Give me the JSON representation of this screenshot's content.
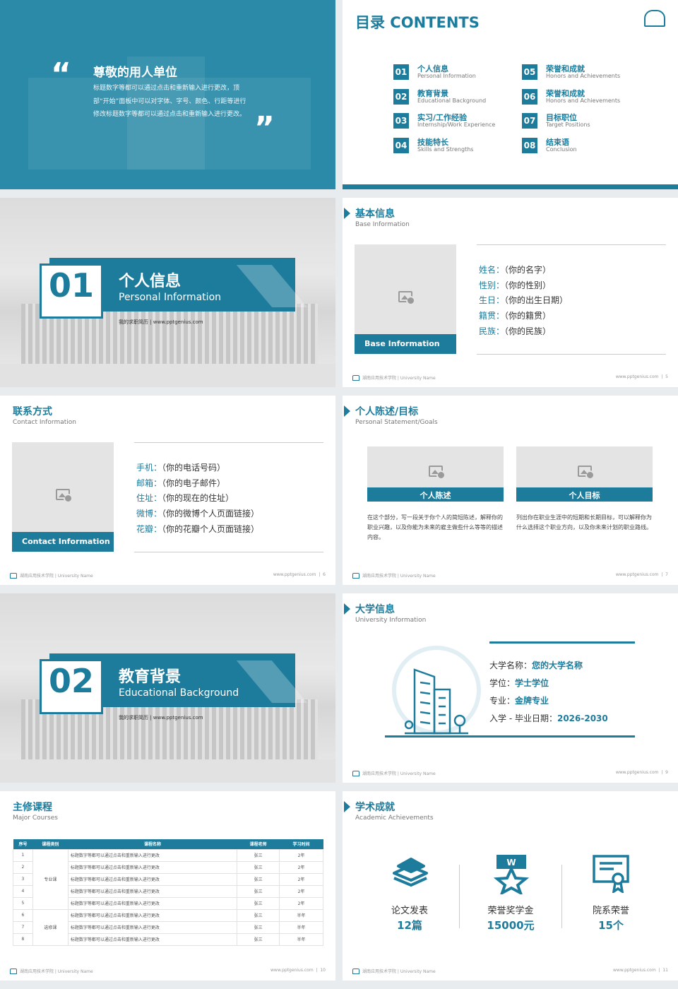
{
  "s1": {
    "title": "尊敬的用人单位",
    "body": "标题数字等都可以通过点击和重新输入进行更改，顶部“开始”面板中可以对字体、字号、颜色、行距等进行修改标题数字等都可以通过点击和重新输入进行更改。",
    "quote_open": "“",
    "quote_close": "”"
  },
  "contents": {
    "title": "目录 CONTENTS",
    "items": [
      {
        "num": "01",
        "zh": "个人信息",
        "en": "Personal Information"
      },
      {
        "num": "02",
        "zh": "教育背景",
        "en": "Educational Background"
      },
      {
        "num": "03",
        "zh": "实习/工作经验",
        "en": "Internship/Work Experience"
      },
      {
        "num": "04",
        "zh": "技能特长",
        "en": "Skills and Strengths"
      },
      {
        "num": "05",
        "zh": "荣誉和成就",
        "en": "Honors and Achievements"
      },
      {
        "num": "06",
        "zh": "荣誉和成就",
        "en": "Honors and Achievements"
      },
      {
        "num": "07",
        "zh": "目标职位",
        "en": "Target Positions"
      },
      {
        "num": "08",
        "zh": "结束语",
        "en": "Conclusion"
      }
    ]
  },
  "sec1": {
    "num": "01",
    "zh": "个人信息",
    "en": "Personal Information",
    "sub": "我的求职简历 | www.pptgenius.com"
  },
  "sec2": {
    "num": "02",
    "zh": "教育背景",
    "en": "Educational Background",
    "sub": "我的求职简历 | www.pptgenius.com"
  },
  "base": {
    "zh": "基本信息",
    "en": "Base Information",
    "caption": "Base Information",
    "rows": [
      {
        "k": "姓名：",
        "v": "（你的名字）"
      },
      {
        "k": "性别：",
        "v": "（你的性别）"
      },
      {
        "k": "生日：",
        "v": "（你的出生日期）"
      },
      {
        "k": "籍贯：",
        "v": "（你的籍贯）"
      },
      {
        "k": "民族：",
        "v": "（你的民族）"
      }
    ],
    "page": "5"
  },
  "contact": {
    "zh": "联系方式",
    "en": "Contact Information",
    "caption": "Contact Information",
    "rows": [
      {
        "k": "手机：",
        "v": "（你的电话号码）"
      },
      {
        "k": "邮箱：",
        "v": "（你的电子邮件）"
      },
      {
        "k": "住址：",
        "v": "（你的现在的住址）"
      },
      {
        "k": "微博：",
        "v": "（你的微博个人页面链接）"
      },
      {
        "k": "花瓣：",
        "v": "（你的花瓣个人页面链接）"
      }
    ],
    "page": "6"
  },
  "statement": {
    "zh": "个人陈述/目标",
    "en": "Personal Statement/Goals",
    "left_cap": "个人陈述",
    "right_cap": "个人目标",
    "left_text": "在这个部分，写一段关于你个人的简短陈述，解释你的职业兴趣，以及你能为未来的雇主做些什么等等的描述内容。",
    "right_text": "列出你在职业生涯中的短期和长期目标，可以解释你为什么选择这个职业方向，以及你未来计划的职业路线。",
    "page": "7"
  },
  "uni": {
    "zh": "大学信息",
    "en": "University Information",
    "rows": [
      {
        "k": "大学名称：",
        "v": "您的大学名称"
      },
      {
        "k": "学位：",
        "v": "学士学位"
      },
      {
        "k": "专业：",
        "v": "金牌专业"
      },
      {
        "k": "入学 - 毕业日期：",
        "v": "2026-2030"
      }
    ],
    "page": "9"
  },
  "courses": {
    "zh": "主修课程",
    "en": "Major Courses",
    "headers": [
      "序号",
      "课程类别",
      "课程名称",
      "课程老师",
      "学习时间"
    ],
    "category_a": "专业课",
    "category_b": "选修课",
    "rows": [
      {
        "n": "1",
        "name": "标题数字等都可以通过点击和重新输入进行更改",
        "t": "张三",
        "time": "2年"
      },
      {
        "n": "2",
        "name": "标题数字等都可以通过点击和重新输入进行更改",
        "t": "张三",
        "time": "2年"
      },
      {
        "n": "3",
        "name": "标题数字等都可以通过点击和重新输入进行更改",
        "t": "张三",
        "time": "2年"
      },
      {
        "n": "4",
        "name": "标题数字等都可以通过点击和重新输入进行更改",
        "t": "张三",
        "time": "2年"
      },
      {
        "n": "5",
        "name": "标题数字等都可以通过点击和重新输入进行更改",
        "t": "张三",
        "time": "2年"
      },
      {
        "n": "6",
        "name": "标题数字等都可以通过点击和重新输入进行更改",
        "t": "张三",
        "time": "半年"
      },
      {
        "n": "7",
        "name": "标题数字等都可以通过点击和重新输入进行更改",
        "t": "张三",
        "time": "半年"
      },
      {
        "n": "8",
        "name": "标题数字等都可以通过点击和重新输入进行更改",
        "t": "张三",
        "time": "半年"
      }
    ],
    "page": "10"
  },
  "academic": {
    "zh": "学术成就",
    "en": "Academic Achievements",
    "items": [
      {
        "label": "论文发表",
        "value": "12篇",
        "icon": "papers-icon"
      },
      {
        "label": "荣誉奖学金",
        "value": "15000元",
        "icon": "medal-icon"
      },
      {
        "label": "院系荣誉",
        "value": "15个",
        "icon": "certificate-icon"
      }
    ],
    "page": "11"
  },
  "footer": {
    "left": "湖南应用技术学院 | University Name",
    "url": "www.pptgenius.com",
    "sep": "|"
  },
  "colors": {
    "accent": "#1d7c9c"
  }
}
